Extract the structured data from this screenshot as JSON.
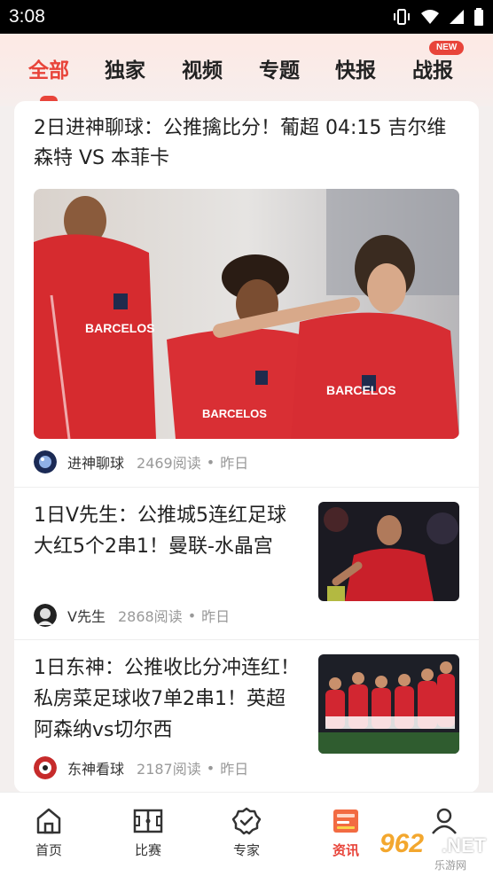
{
  "status": {
    "time": "3:08"
  },
  "tabs": [
    {
      "label": "全部",
      "active": true
    },
    {
      "label": "独家"
    },
    {
      "label": "视频"
    },
    {
      "label": "专题"
    },
    {
      "label": "快报"
    },
    {
      "label": "战报",
      "badge": "NEW"
    }
  ],
  "articles": [
    {
      "title": "2日进神聊球：公推擒比分！葡超 04:15 吉尔维森特 VS 本菲卡",
      "author": "进神聊球",
      "reads": "2469阅读",
      "time": "昨日",
      "hero": {
        "jersey_text": "BARCELOS"
      }
    },
    {
      "title": "1日V先生：公推城5连红足球大红5个2串1！曼联-水晶宫",
      "author": "V先生",
      "reads": "2868阅读",
      "time": "昨日"
    },
    {
      "title": "1日东神：公推收比分冲连红！私房菜足球收7单2串1！英超阿森纳vs切尔西",
      "author": "东神看球",
      "reads": "2187阅读",
      "time": "昨日"
    }
  ],
  "nav": [
    {
      "label": "首页",
      "icon": "home-icon"
    },
    {
      "label": "比赛",
      "icon": "pitch-icon"
    },
    {
      "label": "专家",
      "icon": "badge-check-icon"
    },
    {
      "label": "资讯",
      "icon": "news-icon",
      "active": true
    },
    {
      "label": "我的",
      "icon": "user-icon"
    }
  ],
  "watermark": {
    "big": "962",
    "net": ".NET",
    "sub": "乐游网"
  },
  "colors": {
    "accent": "#e8443a",
    "badge": "#e8443a"
  }
}
